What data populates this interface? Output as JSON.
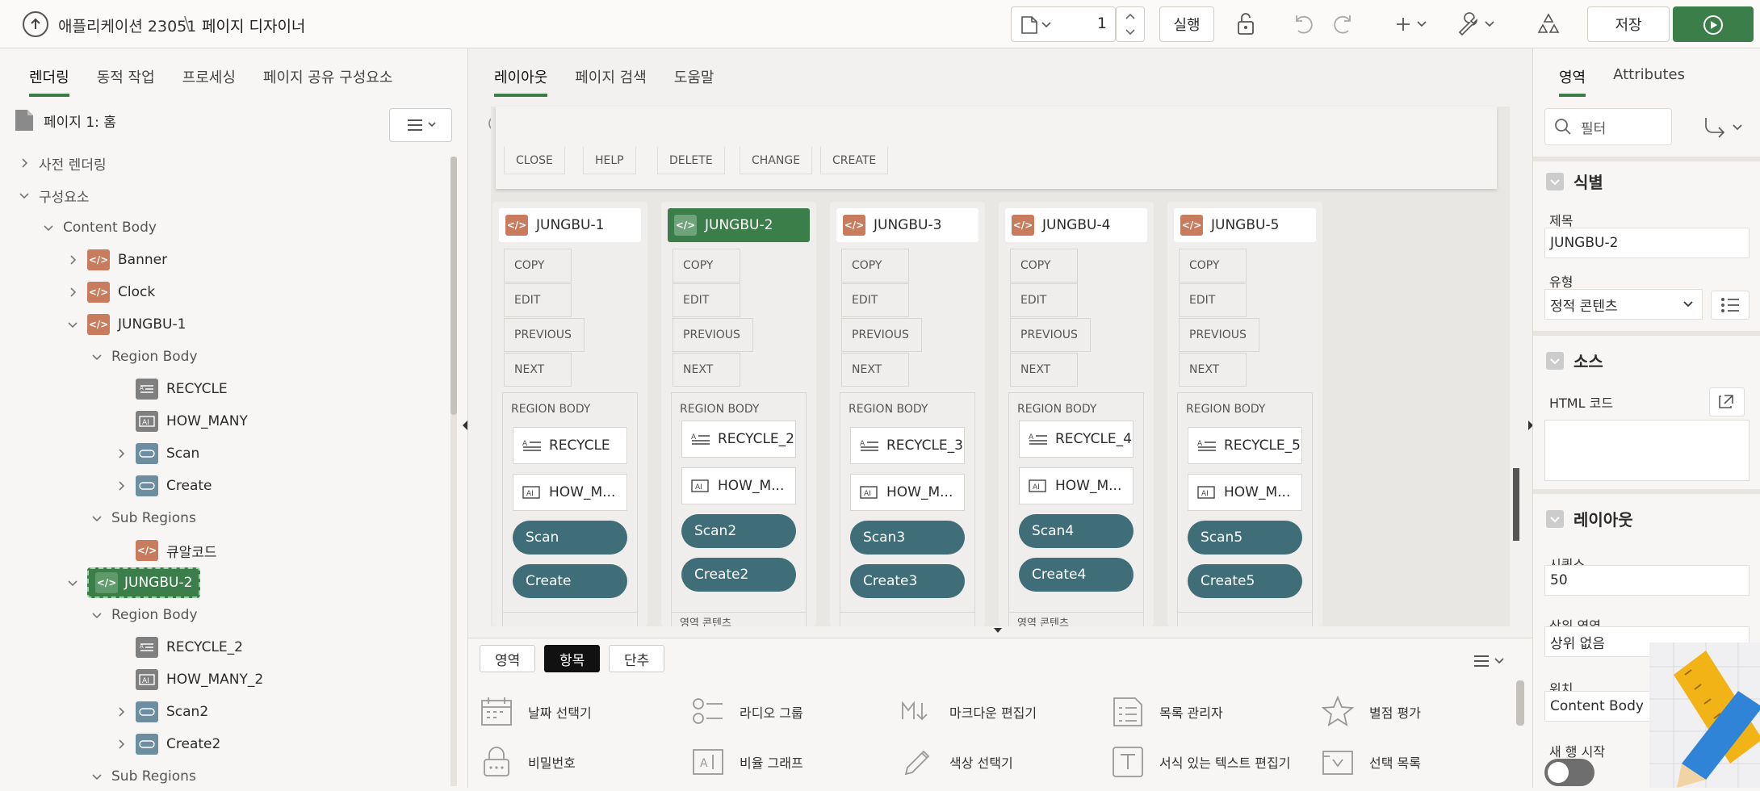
{
  "topbar": {
    "app_title": "애플리케이션 23051",
    "separator": "\\",
    "page_title": "페이지 디자이너",
    "page_number": "1",
    "run_label": "실행",
    "save_label": "저장"
  },
  "left": {
    "tabs": [
      "렌더링",
      "동적 작업",
      "프로세싱",
      "페이지 공유 구성요소"
    ],
    "page_label": "페이지 1: 홈",
    "tree": [
      {
        "label": "사전 렌더링",
        "indent": 0,
        "chev": "right",
        "icon": "none"
      },
      {
        "label": "구성요소",
        "indent": 0,
        "chev": "down",
        "icon": "none"
      },
      {
        "label": "Content Body",
        "indent": 1,
        "chev": "down",
        "icon": "none"
      },
      {
        "label": "Banner",
        "indent": 2,
        "chev": "right",
        "icon": "region"
      },
      {
        "label": "Clock",
        "indent": 2,
        "chev": "right",
        "icon": "region"
      },
      {
        "label": "JUNGBU-1",
        "indent": 2,
        "chev": "down",
        "icon": "region"
      },
      {
        "label": "Region Body",
        "indent": 3,
        "chev": "down",
        "icon": "none"
      },
      {
        "label": "RECYCLE",
        "indent": 4,
        "chev": "none",
        "icon": "textarea"
      },
      {
        "label": "HOW_MANY",
        "indent": 4,
        "chev": "none",
        "icon": "textfield"
      },
      {
        "label": "Scan",
        "indent": 4,
        "chev": "right",
        "icon": "button"
      },
      {
        "label": "Create",
        "indent": 4,
        "chev": "right",
        "icon": "button"
      },
      {
        "label": "Sub Regions",
        "indent": 3,
        "chev": "down",
        "icon": "none"
      },
      {
        "label": "큐알코드",
        "indent": 4,
        "chev": "none",
        "icon": "region"
      },
      {
        "label": "JUNGBU-2",
        "indent": 2,
        "chev": "down",
        "icon": "region-selected"
      },
      {
        "label": "Region Body",
        "indent": 3,
        "chev": "down",
        "icon": "none"
      },
      {
        "label": "RECYCLE_2",
        "indent": 4,
        "chev": "none",
        "icon": "textarea"
      },
      {
        "label": "HOW_MANY_2",
        "indent": 4,
        "chev": "none",
        "icon": "textfield"
      },
      {
        "label": "Scan2",
        "indent": 4,
        "chev": "right",
        "icon": "button"
      },
      {
        "label": "Create2",
        "indent": 4,
        "chev": "right",
        "icon": "button"
      },
      {
        "label": "Sub Regions",
        "indent": 3,
        "chev": "down",
        "icon": "none"
      }
    ]
  },
  "mid": {
    "tabs": [
      "레이아웃",
      "페이지 검색",
      "도움말"
    ],
    "top_buttons": [
      "CLOSE",
      "HELP",
      "DELETE",
      "CHANGE",
      "CREATE"
    ],
    "columns": [
      {
        "title": "JUNGBU-1",
        "selected": false,
        "buttons": [
          "COPY",
          "EDIT",
          "PREVIOUS",
          "NEXT"
        ],
        "body_label": "REGION BODY",
        "item1": "RECYCLE",
        "item2": "HOW_M...",
        "pill1": "Scan",
        "pill2": "Create",
        "footer": ""
      },
      {
        "title": "JUNGBU-2",
        "selected": true,
        "buttons": [
          "COPY",
          "EDIT",
          "PREVIOUS",
          "NEXT"
        ],
        "body_label": "REGION BODY",
        "item1": "RECYCLE_2",
        "item2": "HOW_M...",
        "pill1": "Scan2",
        "pill2": "Create2",
        "footer": "영역 콘텐츠"
      },
      {
        "title": "JUNGBU-3",
        "selected": false,
        "buttons": [
          "COPY",
          "EDIT",
          "PREVIOUS",
          "NEXT"
        ],
        "body_label": "REGION BODY",
        "item1": "RECYCLE_3",
        "item2": "HOW_M...",
        "pill1": "Scan3",
        "pill2": "Create3",
        "footer": ""
      },
      {
        "title": "JUNGBU-4",
        "selected": false,
        "buttons": [
          "COPY",
          "EDIT",
          "PREVIOUS",
          "NEXT"
        ],
        "body_label": "REGION BODY",
        "item1": "RECYCLE_4",
        "item2": "HOW_M...",
        "pill1": "Scan4",
        "pill2": "Create4",
        "footer": "영역 콘텐츠"
      },
      {
        "title": "JUNGBU-5",
        "selected": false,
        "buttons": [
          "COPY",
          "EDIT",
          "PREVIOUS",
          "NEXT"
        ],
        "body_label": "REGION BODY",
        "item1": "RECYCLE_5",
        "item2": "HOW_M...",
        "pill1": "Scan5",
        "pill2": "Create5",
        "footer": ""
      }
    ],
    "palette_tabs": [
      "영역",
      "항목",
      "단추"
    ],
    "palette_items": [
      {
        "label": "날짜 선택기",
        "icon": "calendar-icon"
      },
      {
        "label": "라디오 그룹",
        "icon": "radio-group-icon"
      },
      {
        "label": "마크다운 편집기",
        "icon": "markdown-icon"
      },
      {
        "label": "목록 관리자",
        "icon": "list-manager-icon"
      },
      {
        "label": "별점 평가",
        "icon": "star-icon"
      },
      {
        "label": "비밀번호",
        "icon": "lock-icon"
      },
      {
        "label": "비율 그래프",
        "icon": "ratio-graph-icon"
      },
      {
        "label": "색상 선택기",
        "icon": "color-picker-icon"
      },
      {
        "label": "서식 있는 텍스트 편집기",
        "icon": "rich-text-icon"
      },
      {
        "label": "선택 목록",
        "icon": "select-list-icon"
      }
    ]
  },
  "right": {
    "tabs": [
      "영역",
      "Attributes"
    ],
    "filter_placeholder": "필터",
    "section_identification": "식별",
    "title_label": "제목",
    "title_value": "JUNGBU-2",
    "type_label": "유형",
    "type_value": "정적 콘텐츠",
    "section_source": "소스",
    "html_code_label": "HTML 코드",
    "section_layout": "레이아웃",
    "sequence_label": "시퀀스",
    "sequence_value": "50",
    "parent_label": "상위 영역",
    "parent_value": "상위 없음",
    "position_label": "위치",
    "position_value": "Content Body",
    "new_row_label": "새 행 시작"
  },
  "colors": {
    "accent": "#3b7e4a",
    "region_icon": "#c97c5d",
    "button_pill": "#3f6e78"
  }
}
